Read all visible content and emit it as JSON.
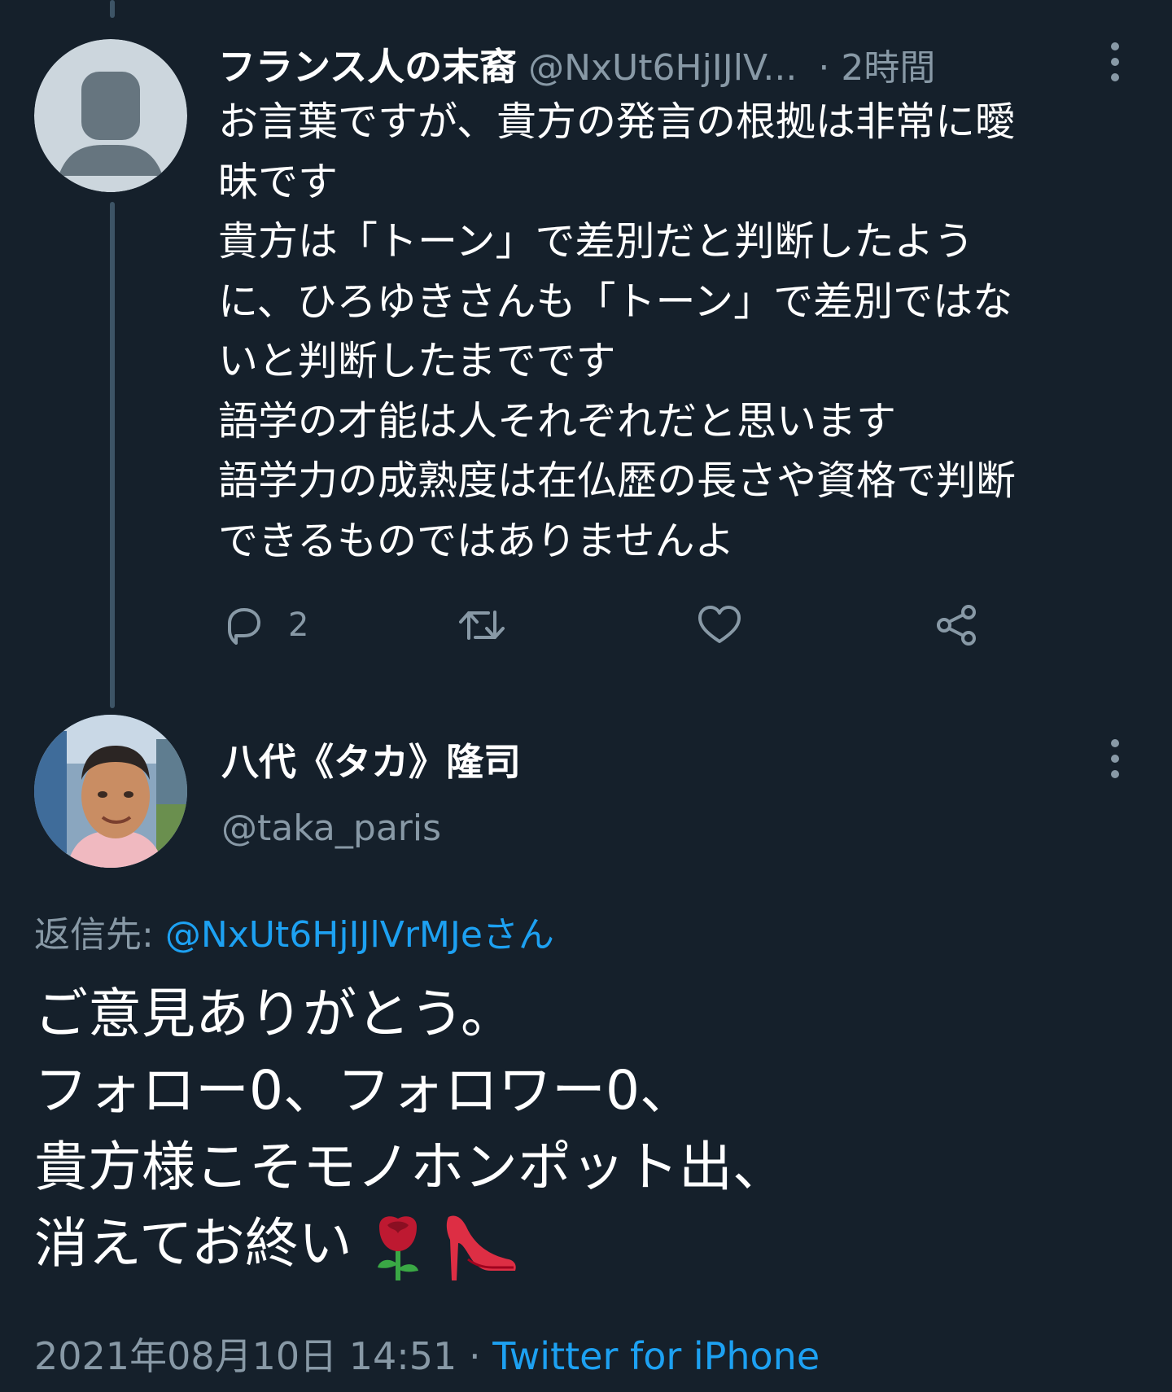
{
  "reply_tweet": {
    "display_name": "フランス人の末裔",
    "handle": "@NxUt6HjIJlV...",
    "time": "· 2時間",
    "lines": [
      "お言葉ですが、貴方の発言の根拠は非常に曖",
      "昧です",
      "貴方は「トーン」で差別だと判断したよう",
      "に、ひろゆきさんも「トーン」で差別ではな",
      "いと判断したまでです",
      "語学の才能は人それぞれだと思います",
      "語学力の成熟度は在仏歴の長さや資格で判断",
      "できるものではありませんよ"
    ],
    "reply_count": "2",
    "icons": [
      "reply-icon",
      "retweet-icon",
      "like-icon",
      "share-icon",
      "more-icon"
    ]
  },
  "main_tweet": {
    "display_name": "八代《タカ》隆司",
    "handle": "@taka_paris",
    "reply_to_label": "返信先:",
    "reply_to_target": "@NxUt6HjIJlVrMJeさん",
    "lines": [
      "ご意見ありがとう。",
      "フォロー0、フォロワー0、",
      "貴方様こそモノホンポット出、",
      "消えてお終い"
    ],
    "emojis": [
      "rose-emoji",
      "high-heel-emoji"
    ],
    "timestamp": "2021年08月10日 14:51",
    "separator": " · ",
    "source": "Twitter for iPhone"
  },
  "colors": {
    "background": "#15202b",
    "text": "#ffffff",
    "muted": "#8899a6",
    "link": "#1da1f2",
    "thread_line": "#3d5466"
  }
}
